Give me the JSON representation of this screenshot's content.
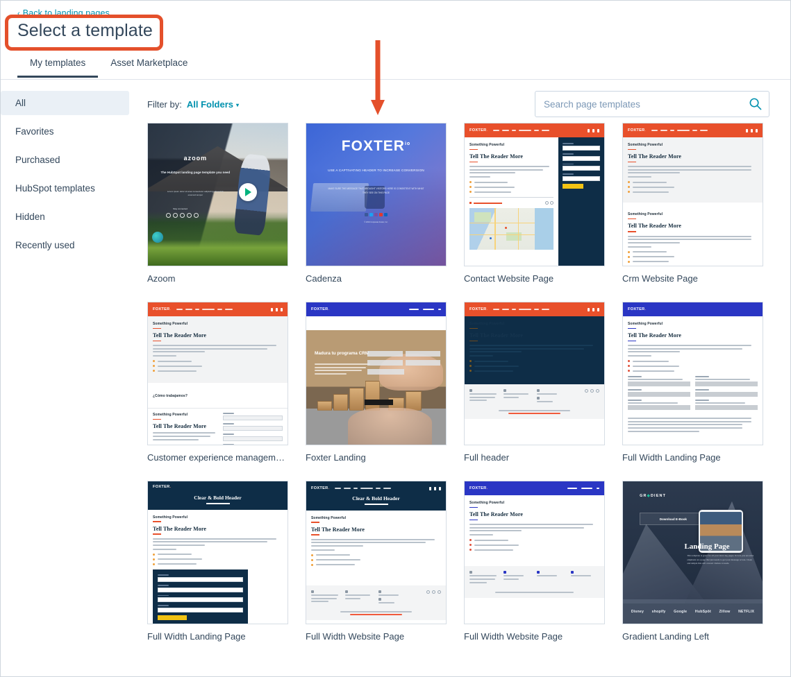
{
  "header": {
    "back_link": "Back to landing pages",
    "back_chevron": "‹",
    "title": "Select a template",
    "tabs": [
      {
        "label": "My templates",
        "active": true
      },
      {
        "label": "Asset Marketplace",
        "active": false
      }
    ]
  },
  "sidebar": {
    "items": [
      {
        "label": "All",
        "active": true
      },
      {
        "label": "Favorites",
        "active": false
      },
      {
        "label": "Purchased",
        "active": false
      },
      {
        "label": "HubSpot templates",
        "active": false
      },
      {
        "label": "Hidden",
        "active": false
      },
      {
        "label": "Recently used",
        "active": false
      }
    ]
  },
  "filter": {
    "label": "Filter by:",
    "value": "All Folders",
    "caret": "▾"
  },
  "search": {
    "placeholder": "Search page templates",
    "value": "",
    "icon": "search-icon"
  },
  "templates": [
    {
      "name": "Azoom",
      "style": "azoom"
    },
    {
      "name": "Cadenza",
      "style": "cadenza"
    },
    {
      "name": "Contact Website Page",
      "style": "contact"
    },
    {
      "name": "Crm Website Page",
      "style": "crm"
    },
    {
      "name": "Customer experience managemen…",
      "style": "cem"
    },
    {
      "name": "Foxter Landing",
      "style": "foxter"
    },
    {
      "name": "Full header",
      "style": "fullheader"
    },
    {
      "name": "Full Width Landing Page",
      "style": "fwlp"
    },
    {
      "name": "Full Width Landing Page",
      "style": "fwlp2"
    },
    {
      "name": "Full Width Website Page",
      "style": "fwwp"
    },
    {
      "name": "Full Width Website Page",
      "style": "fwwp2"
    },
    {
      "name": "Gradient Landing Left",
      "style": "gradient"
    }
  ],
  "preview_text": {
    "brand": "FOXTER",
    "brand_dot": ".",
    "heading_small": "Something Powerful",
    "heading_big": "Tell The Reader More",
    "clear_bold_header": "Clear & Bold Header",
    "azoom_logo": "azoom",
    "azoom_tagline": "The HubSpot landing page template you need",
    "azoom_social_label": "Stay connected",
    "cadenza_logo": "FOXTER",
    "cadenza_logo_suffix": "io",
    "cadenza_headline": "USE A CAPTIVATING HEADER TO INCREASE CONVERSION",
    "cadenza_sub": "MAKE SURE THE MESSAGE THAT BROUGHT VISITORS HERE IS CONSISTENT WITH WHAT THEY SEE ON THIS PAGE",
    "cadenza_copyright": "© 2019 Corporate Foxter, Inc.",
    "foxter_title": "Madura tu programa CRM",
    "cem_question": "¿Cómo trabajamos?",
    "gradient_logo": "GR",
    "gradient_logo_accent": "◆",
    "gradient_logo_rest": "DIENT",
    "gradient_button": "Download E-Book",
    "gradient_title": "Landing Page",
    "gradient_paragraph": "This template is great for all your land- ing pages. Its lets you set extra emphasis on a page that just needs to get your message across. Clean and simple this will convert visitors to leads.",
    "gradient_brands": [
      "Disney",
      "shopify",
      "Google",
      "HubSpōt",
      "Zillow",
      "NETFLIX"
    ]
  },
  "colors": {
    "accent_teal": "#0091ae",
    "text_dark": "#33475b",
    "sidebar_active_bg": "#eaf0f6",
    "border": "#cbd6e2",
    "annotation_red": "#e4502b",
    "brand_orange": "#e8502b",
    "brand_navy": "#0e2d47",
    "brand_blue": "#2a36c4"
  }
}
